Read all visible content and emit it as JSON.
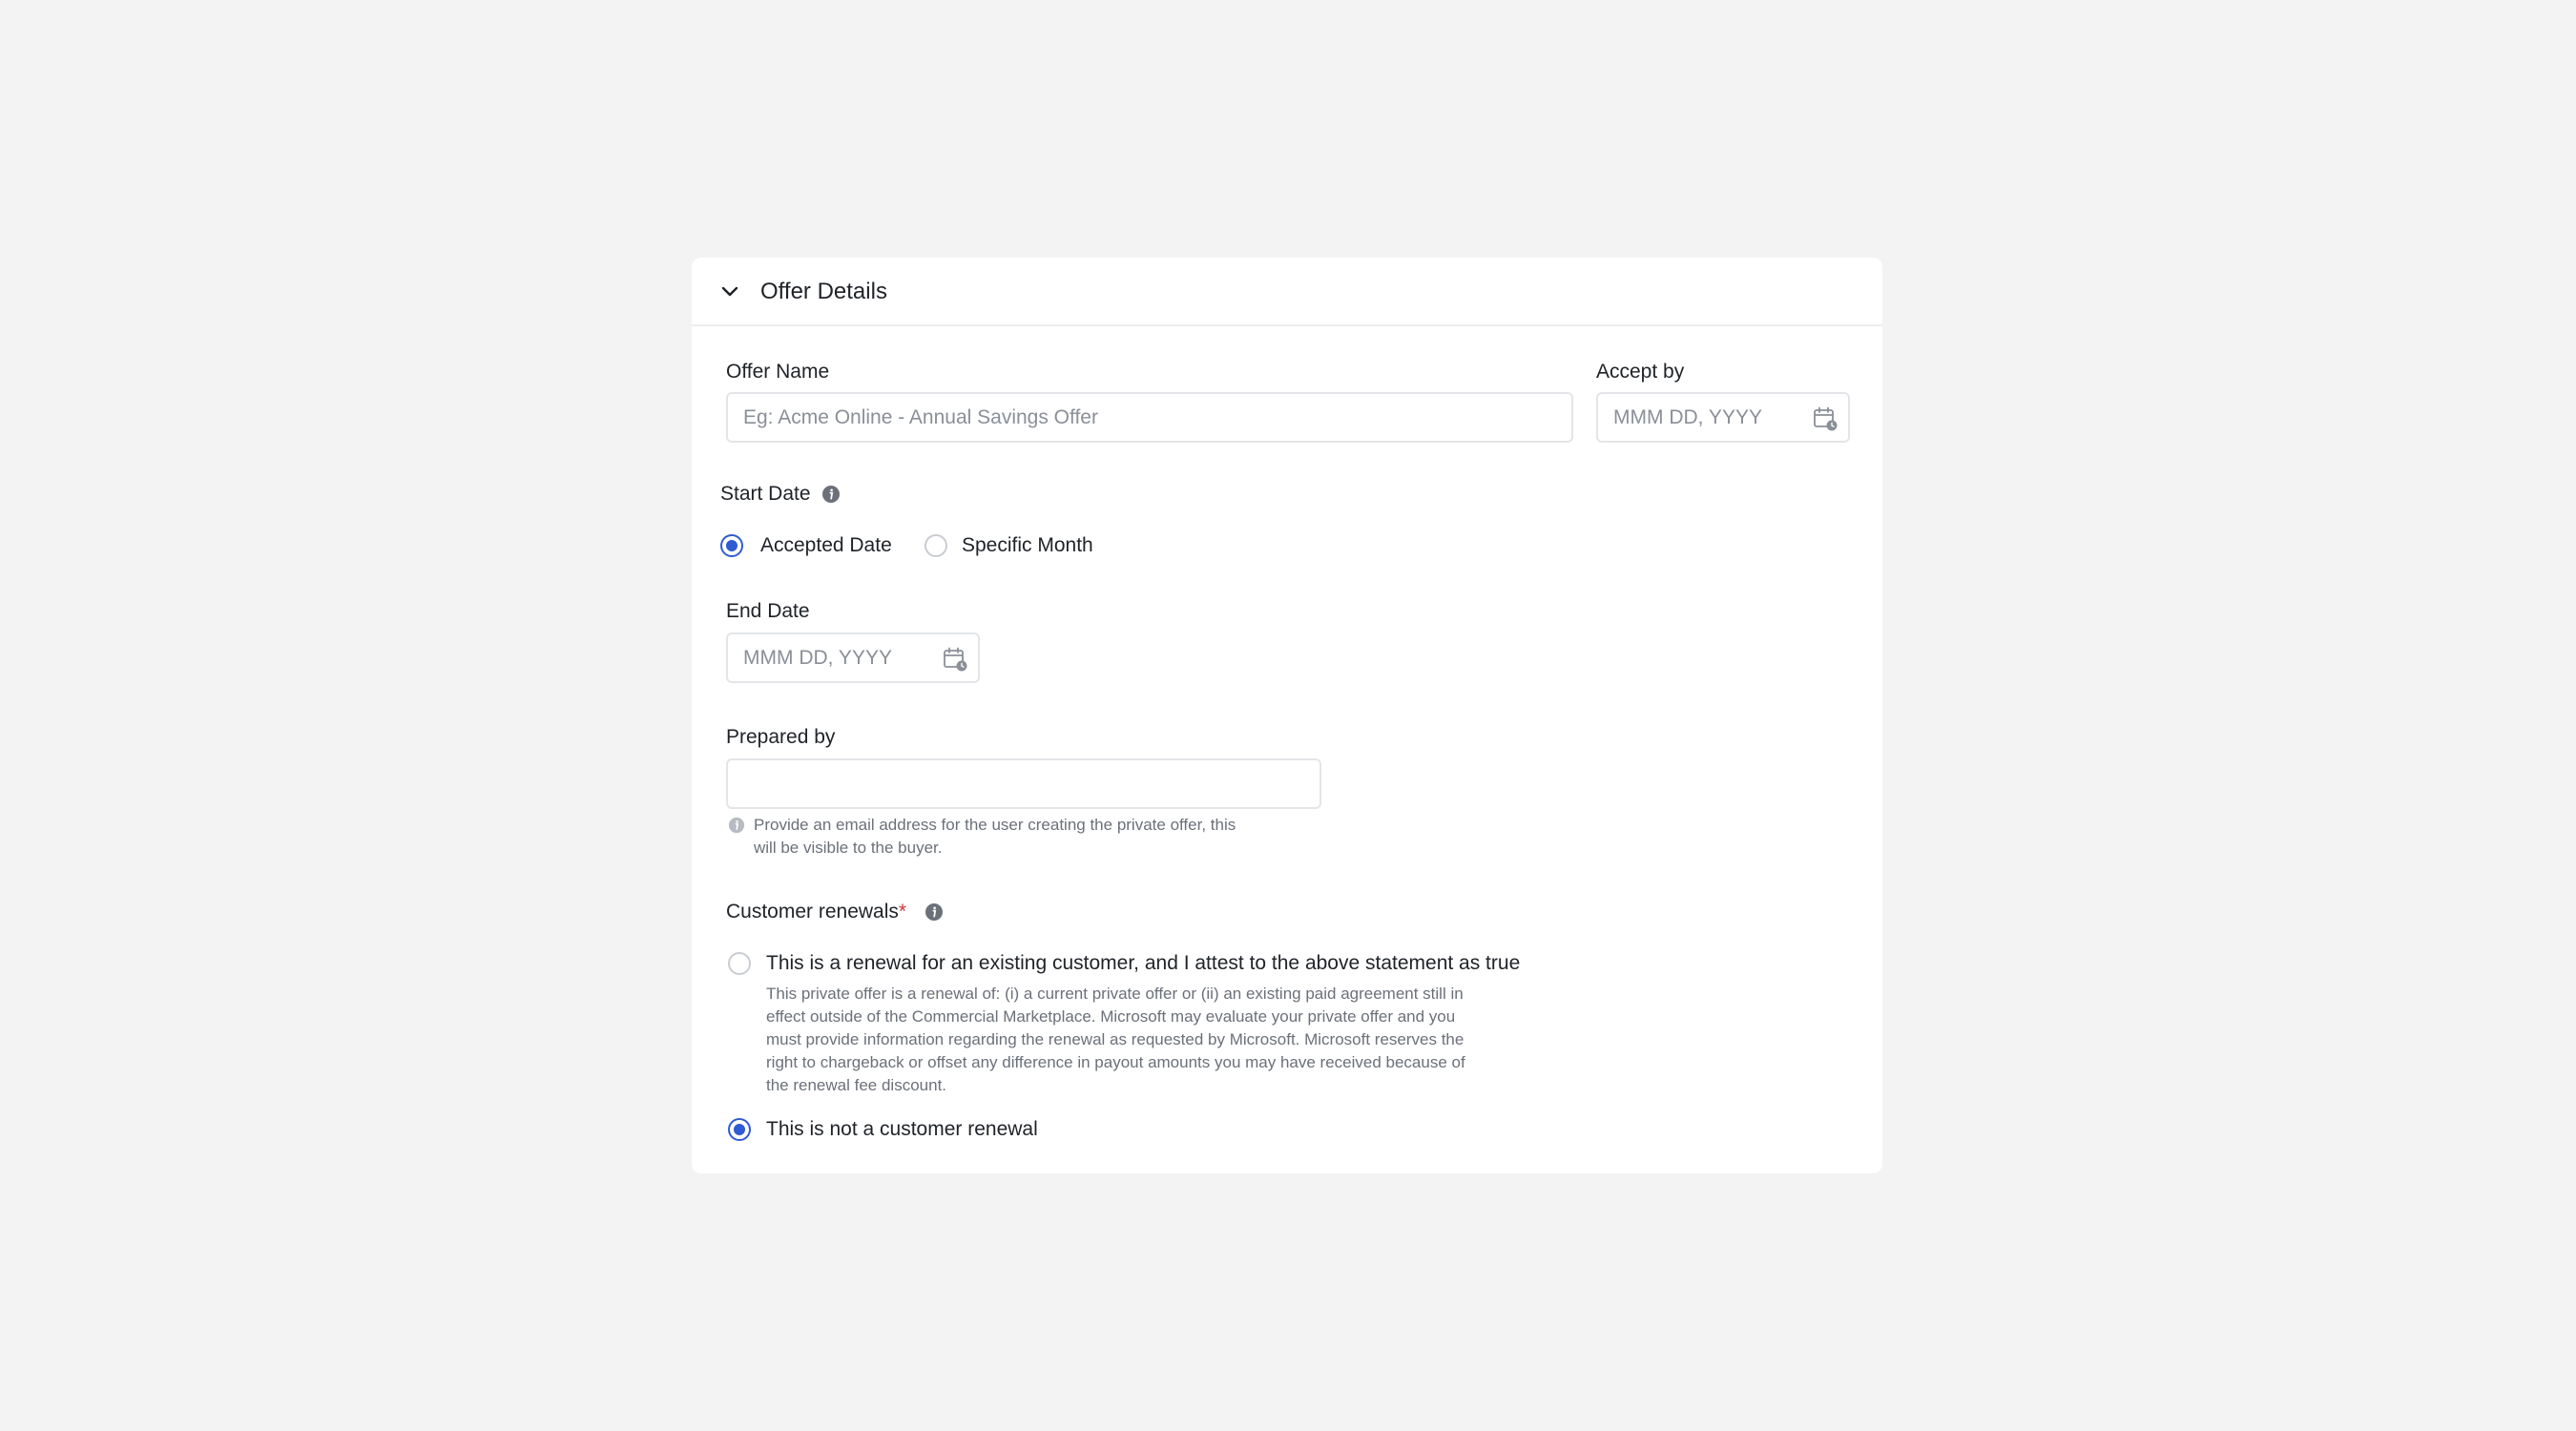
{
  "header": {
    "title": "Offer Details"
  },
  "offer_name": {
    "label": "Offer Name",
    "placeholder": "Eg: Acme Online - Annual Savings Offer",
    "value": ""
  },
  "accept_by": {
    "label": "Accept by",
    "placeholder": "MMM DD, YYYY",
    "value": ""
  },
  "start_date": {
    "label": "Start Date",
    "options": [
      {
        "label": "Accepted Date",
        "selected": true
      },
      {
        "label": "Specific Month",
        "selected": false
      }
    ]
  },
  "end_date": {
    "label": "End Date",
    "placeholder": "MMM DD, YYYY",
    "value": ""
  },
  "prepared_by": {
    "label": "Prepared by",
    "value": "",
    "helper_line1": "Provide an email address for the user creating the private offer, this",
    "helper_line2": "will be visible to the buyer."
  },
  "customer_renewals": {
    "label": "Customer renewals",
    "required_mark": "*",
    "options": [
      {
        "label": "This is a renewal for an existing customer, and I attest to the above statement as true",
        "selected": false,
        "description": [
          "This private offer is a renewal of: (i) a current private offer or (ii) an existing paid agreement still in",
          "effect outside of the Commercial Marketplace. Microsoft may evaluate your private offer and you",
          "must provide information regarding the renewal as requested by Microsoft. Microsoft reserves the",
          "right to chargeback or offset any difference in payout amounts you may have received because of",
          "the renewal fee discount."
        ]
      },
      {
        "label": "This is not a customer renewal",
        "selected": true
      }
    ]
  },
  "colors": {
    "accent": "#2f5bd3",
    "required": "#d13438",
    "background": "#f3f3f3",
    "card": "#ffffff"
  }
}
